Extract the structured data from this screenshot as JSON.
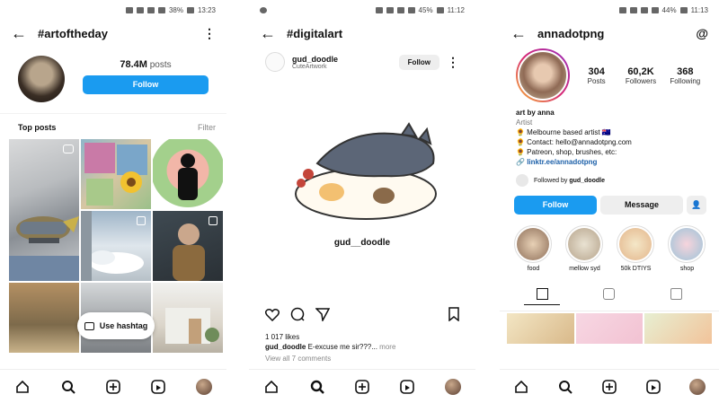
{
  "panel1": {
    "status": {
      "battery": "38%",
      "time": "13:23"
    },
    "title": "#artoftheday",
    "posts_count": "78.4M",
    "posts_label": "posts",
    "follow_label": "Follow",
    "top_posts_label": "Top posts",
    "filter_label": "Filter",
    "use_hashtag_label": "Use hashtag"
  },
  "panel2": {
    "status": {
      "battery": "45%",
      "time": "11:12"
    },
    "title": "#digitalart",
    "username": "gud_doodle",
    "subtitle": "CuteArtwork",
    "follow_label": "Follow",
    "image_signature": "gud__doodle",
    "likes": "1 017 likes",
    "caption_user": "gud_doodle",
    "caption_text": "E-excuse me sir???...",
    "caption_more": "more",
    "view_comments": "View all 7 comments"
  },
  "panel3": {
    "status": {
      "battery": "44%",
      "time": "11:13"
    },
    "username": "annadotpng",
    "stats": [
      {
        "value": "304",
        "label": "Posts"
      },
      {
        "value": "60,2K",
        "label": "Followers"
      },
      {
        "value": "368",
        "label": "Following"
      }
    ],
    "bio": {
      "name": "art by anna",
      "category": "Artist",
      "lines": [
        "🌻 Melbourne based artist 🇦🇺",
        "🌻 Contact: hello@annadotpng.com",
        "🌻 Patreon, shop, brushes, etc:"
      ],
      "link": "linktr.ee/annadotpng"
    },
    "followed_by_prefix": "Followed by",
    "followed_by_user": "gud_doodle",
    "follow_label": "Follow",
    "message_label": "Message",
    "highlights": [
      "food",
      "mellow syd",
      "50k DTIYS",
      "shop"
    ]
  },
  "colors": {
    "accent": "#1a9bf0",
    "link": "#1b5fa8"
  }
}
